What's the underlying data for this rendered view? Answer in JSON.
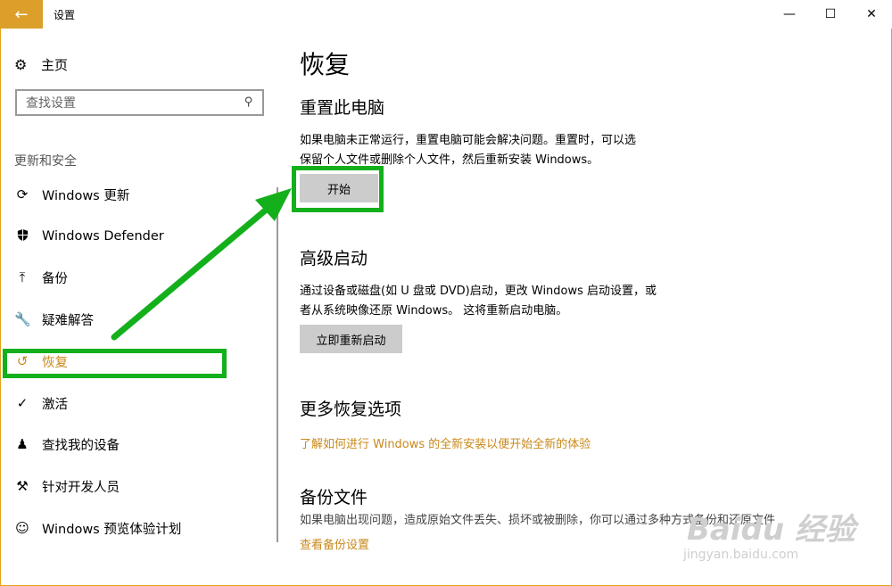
{
  "window": {
    "title": "设置",
    "minimize": "—",
    "maximize": "☐",
    "close": "✕"
  },
  "sidebar": {
    "home_label": "主页",
    "search_placeholder": "查找设置",
    "section_label": "更新和安全",
    "items": [
      {
        "label": "Windows 更新",
        "icon": "refresh-icon"
      },
      {
        "label": "Windows Defender",
        "icon": "shield-icon"
      },
      {
        "label": "备份",
        "icon": "upload-icon"
      },
      {
        "label": "疑难解答",
        "icon": "wrench-icon"
      },
      {
        "label": "恢复",
        "icon": "history-icon",
        "active": true
      },
      {
        "label": "激活",
        "icon": "check-circle-icon"
      },
      {
        "label": "查找我的设备",
        "icon": "person-icon"
      },
      {
        "label": "针对开发人员",
        "icon": "tools-icon"
      },
      {
        "label": "Windows 预览体验计划",
        "icon": "cat-icon"
      }
    ]
  },
  "main": {
    "title": "恢复",
    "reset": {
      "heading": "重置此电脑",
      "line1": "如果电脑未正常运行，重置电脑可能会解决问题。重置时，可以选",
      "line2": "保留个人文件或删除个人文件，然后重新安装 Windows。",
      "button": "开始"
    },
    "advanced": {
      "heading": "高级启动",
      "line1": "通过设备或磁盘(如 U 盘或 DVD)启动，更改 Windows 启动设置，或",
      "line2": "者从系统映像还原 Windows。 这将重新启动电脑。",
      "button": "立即重新启动"
    },
    "more": {
      "heading": "更多恢复选项",
      "link": "了解如何进行 Windows 的全新安装以便开始全新的体验"
    },
    "backup": {
      "heading": "备份文件",
      "line1": "如果电脑出现问题，造成原始文件丢失、损坏或被删除，你可以通过多种方式备份和还原文件",
      "link": "查看备份设置"
    }
  },
  "watermark": {
    "text": "Baidu 经验",
    "sub": "jingyan.baidu.com"
  },
  "colors": {
    "accent": "#dca02a",
    "link": "#c8891c",
    "highlight": "#13b01c",
    "button": "#cccccc"
  }
}
